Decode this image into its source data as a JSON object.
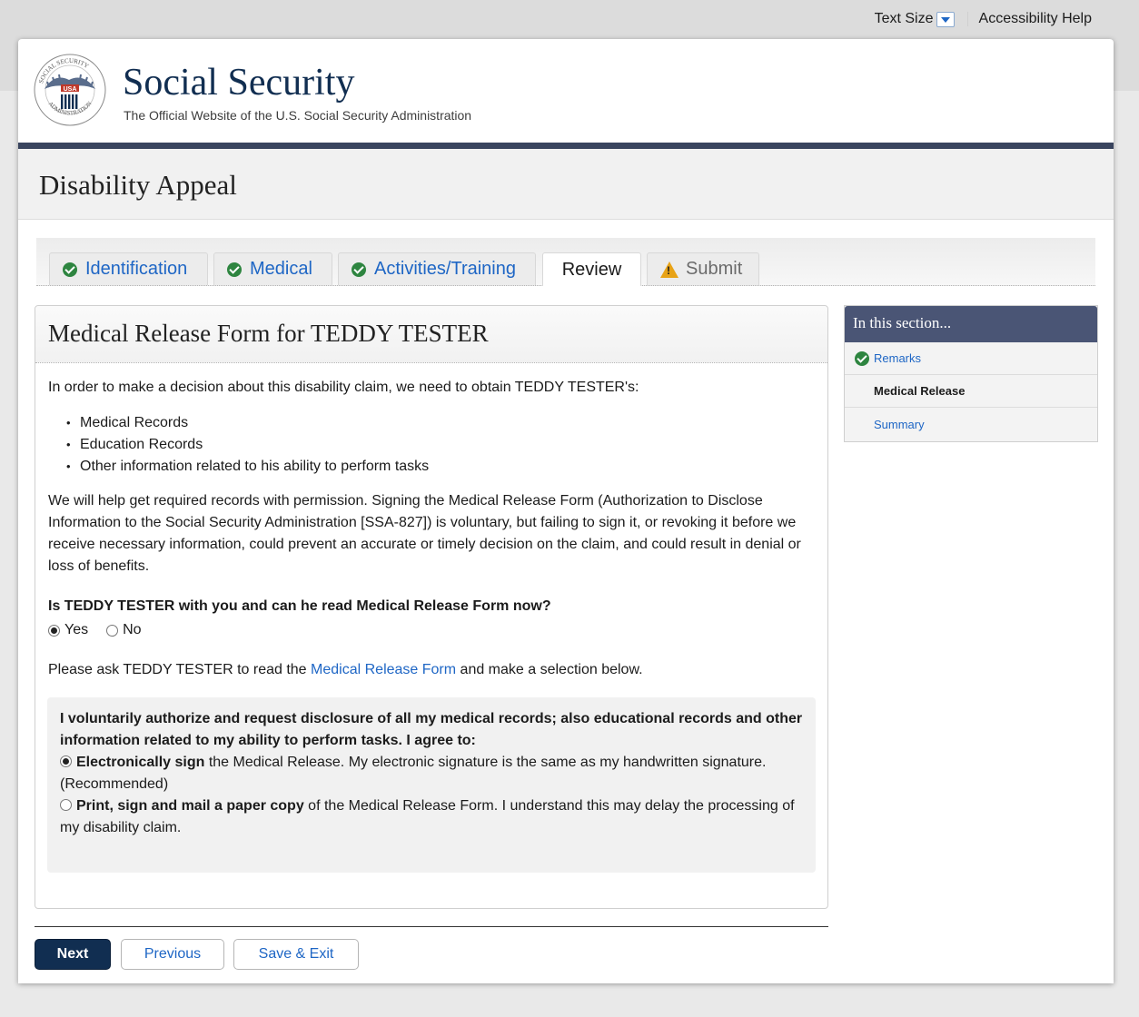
{
  "topbar": {
    "text_size": "Text Size",
    "accessibility_help": "Accessibility Help"
  },
  "brand": {
    "title": "Social Security",
    "subtitle": "The Official Website of the U.S. Social Security Administration",
    "seal_text": "SOCIAL SECURITY ADMINISTRATION USA"
  },
  "app": {
    "title": "Disability Appeal"
  },
  "tabs": [
    {
      "label": "Identification",
      "status": "complete"
    },
    {
      "label": "Medical",
      "status": "complete"
    },
    {
      "label": "Activities/Training",
      "status": "complete"
    },
    {
      "label": "Review",
      "status": "current"
    },
    {
      "label": "Submit",
      "status": "warning"
    }
  ],
  "main": {
    "heading": "Medical Release Form for TEDDY TESTER",
    "intro": "In order to make a decision about this disability claim, we need to obtain TEDDY TESTER's:",
    "bullets": [
      "Medical Records",
      "Education Records",
      "Other information related to his ability to perform tasks"
    ],
    "paragraph": "We will help get required records with permission. Signing the Medical Release Form (Authorization to Disclose Information to the Social Security Administration [SSA-827]) is voluntary, but failing to sign it, or revoking it before we receive necessary information, could prevent an accurate or timely decision on the claim, and could result in denial or loss of benefits.",
    "question": "Is TEDDY TESTER with you and can he read Medical Release Form now?",
    "answer_options": [
      "Yes",
      "No"
    ],
    "selected_answer": "Yes",
    "ask_before": "Please ask TEDDY TESTER to read the ",
    "ask_link": "Medical Release Form",
    "ask_after": " and make a selection below.",
    "consent": {
      "intro": "I voluntarily authorize and request disclosure of all my medical records; also educational records and other information related to my ability to perform tasks. I agree to:",
      "option1_bold": "Electronically sign",
      "option1_rest": " the Medical Release. My electronic signature is the same as my handwritten signature. (Recommended)",
      "option2_bold": "Print, sign and mail a paper copy",
      "option2_rest": " of the Medical Release Form. I understand this may delay the processing of my disability claim.",
      "selected": "Electronically sign"
    }
  },
  "sidebar": {
    "title": "In this section...",
    "items": [
      {
        "label": "Remarks",
        "status": "complete"
      },
      {
        "label": "Medical Release",
        "status": "current"
      },
      {
        "label": "Summary",
        "status": "link"
      }
    ]
  },
  "buttons": {
    "next": "Next",
    "previous": "Previous",
    "save_exit": "Save & Exit"
  },
  "colors": {
    "navy": "#112e51",
    "link": "#1e66c5",
    "complete_green": "#2e8540",
    "warning": "#e8a317",
    "sidebar_header": "#4a5575"
  }
}
